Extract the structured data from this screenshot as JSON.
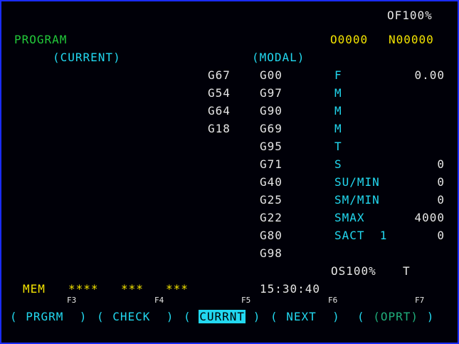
{
  "header": {
    "feed_override": "OF100%",
    "program_label": "PROGRAM",
    "program_number": "O0000",
    "sequence_number": "N00000"
  },
  "sections": {
    "current_label": "(CURRENT)",
    "modal_label": "(MODAL)"
  },
  "current_codes": [
    "G67",
    "G54",
    "G64",
    "G18"
  ],
  "modal_codes": [
    "G00",
    "G97",
    "G90",
    "G69",
    "G95",
    "G71",
    "G40",
    "G25",
    "G22",
    "G80",
    "G98"
  ],
  "parameters": [
    {
      "label": "F",
      "value": "0.00"
    },
    {
      "label": "M",
      "value": ""
    },
    {
      "label": "M",
      "value": ""
    },
    {
      "label": "M",
      "value": ""
    },
    {
      "label": "T",
      "value": ""
    },
    {
      "label": "S",
      "value": "0"
    },
    {
      "label": "SU/MIN",
      "value": "0"
    },
    {
      "label": "SM/MIN",
      "value": "0"
    },
    {
      "label": "SMAX",
      "value": "4000"
    },
    {
      "label": "SACT  1",
      "value": "0"
    }
  ],
  "status": {
    "spindle_override": "OS100%",
    "tool": "T",
    "mode": "MEM",
    "field1": "****",
    "field2": "***",
    "field3": "***",
    "time": "15:30:40"
  },
  "function_keys": [
    "F3",
    "F4",
    "F5",
    "F6",
    "F7"
  ],
  "softkeys": [
    {
      "label": "PRGRM",
      "active": false
    },
    {
      "label": "CHECK",
      "active": false
    },
    {
      "label": "CURRNT",
      "active": true
    },
    {
      "label": "NEXT",
      "active": false
    },
    {
      "label": "(OPRT)",
      "active": false
    }
  ],
  "colors": {
    "background": "#000008",
    "border": "#1a2cff",
    "text": "#e6e6e6",
    "label_green": "#22c93a",
    "cyan": "#22d8f0",
    "yellow": "#f4e400"
  }
}
